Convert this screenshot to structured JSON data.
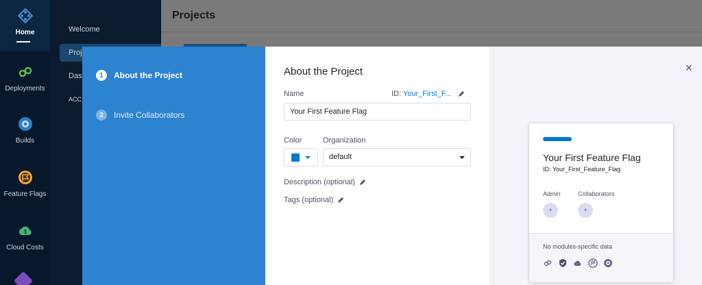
{
  "rail": {
    "items": [
      {
        "label": "Home",
        "icon": "harness-logo-icon"
      },
      {
        "label": "Deployments",
        "icon": "deployments-icon"
      },
      {
        "label": "Builds",
        "icon": "builds-icon"
      },
      {
        "label": "Feature Flags",
        "icon": "feature-flags-icon"
      },
      {
        "label": "Cloud Costs",
        "icon": "cloud-costs-icon"
      }
    ]
  },
  "subnav": {
    "items": [
      "Welcome",
      "Proj",
      "Das",
      "ACC"
    ]
  },
  "background": {
    "title": "Projects"
  },
  "wizard": {
    "steps": [
      {
        "num": "1",
        "label": "About the Project"
      },
      {
        "num": "2",
        "label": "Invite Collaborators"
      }
    ]
  },
  "form": {
    "title": "About the Project",
    "name_label": "Name",
    "id_prefix": "ID:",
    "id_value": "Your_First_F...",
    "name_value": "Your First Feature Flag",
    "color_label": "Color",
    "color_value": "#0278d5",
    "org_label": "Organization",
    "org_value": "default",
    "description_label": "Description (optional)",
    "tags_label": "Tags (optional)"
  },
  "preview": {
    "title": "Your First Feature Flag",
    "id": "ID: Your_First_Feature_Flag",
    "admin_label": "Admin",
    "collaborators_label": "Collaborators",
    "plus": "+",
    "modules_text": "No modules-specific data"
  },
  "close_label": "×"
}
